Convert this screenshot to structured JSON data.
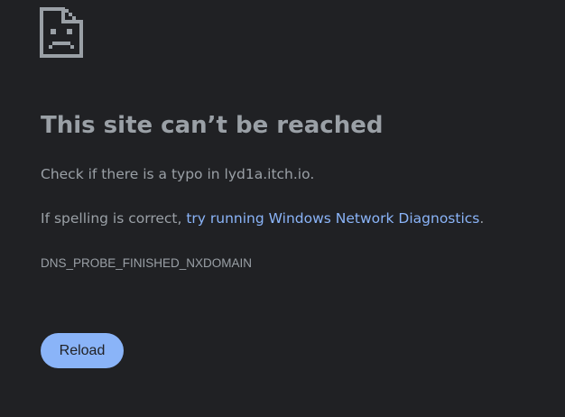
{
  "page": {
    "icon": "sad-page-icon",
    "headline": "This site can’t be reached",
    "typo_prefix": "Check if there is a typo in ",
    "domain": "lyd1a.itch.io",
    "typo_suffix": ".",
    "spelling_prefix": "If spelling is correct, ",
    "diagnostics_link": "try running Windows Network Diagnostics",
    "spelling_suffix": ".",
    "error_code": "DNS_PROBE_FINISHED_NXDOMAIN",
    "reload_label": "Reload"
  },
  "colors": {
    "background": "#202124",
    "text": "#9aa0a6",
    "link": "#8ab4f8",
    "button_bg": "#8ab4f8",
    "button_text": "#202124"
  }
}
